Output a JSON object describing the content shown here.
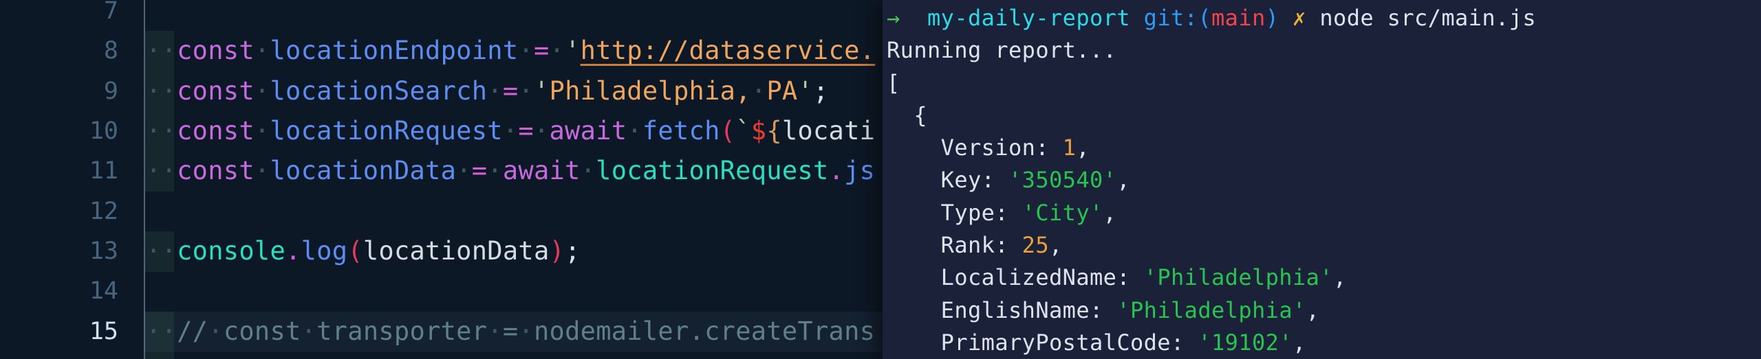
{
  "editor": {
    "colors": {
      "background": "#0d1826",
      "kw": "#c76ae0",
      "op": "#d45fd8",
      "var": "#5e8df2",
      "fn": "#5e8df2",
      "obj": "#28dfc0",
      "dot": "#d45fd8",
      "q": "#b5cbb0",
      "str": "#efa55e",
      "url": "#efa55e",
      "url_underline": "#cf7f35",
      "br": "#e43a5e",
      "dollar": "#ee3a2f",
      "brace": "#d89b57",
      "plain": "#d5dce4",
      "pn": "#dfe4ea",
      "cm": "#5e8086",
      "ws": "#3e5660",
      "line_number": "#47667d",
      "line_number_active": "#cfe3f5"
    },
    "lines": [
      {
        "num": "7",
        "active": false,
        "tokens": []
      },
      {
        "num": "8",
        "active": false,
        "tokens": [
          {
            "t": "··",
            "c": "ws"
          },
          {
            "t": "const",
            "c": "kw"
          },
          {
            "t": "·",
            "c": "ws"
          },
          {
            "t": "locationEndpoint",
            "c": "var"
          },
          {
            "t": "·",
            "c": "ws"
          },
          {
            "t": "=",
            "c": "op"
          },
          {
            "t": "·",
            "c": "ws"
          },
          {
            "t": "'",
            "c": "q"
          },
          {
            "t": "http://dataservice.",
            "c": "url",
            "u": true
          }
        ]
      },
      {
        "num": "9",
        "active": false,
        "tokens": [
          {
            "t": "··",
            "c": "ws"
          },
          {
            "t": "const",
            "c": "kw"
          },
          {
            "t": "·",
            "c": "ws"
          },
          {
            "t": "locationSearch",
            "c": "var"
          },
          {
            "t": "·",
            "c": "ws"
          },
          {
            "t": "=",
            "c": "op"
          },
          {
            "t": "·",
            "c": "ws"
          },
          {
            "t": "'",
            "c": "q"
          },
          {
            "t": "Philadelphia,",
            "c": "str"
          },
          {
            "t": "·",
            "c": "ws"
          },
          {
            "t": "PA",
            "c": "str"
          },
          {
            "t": "'",
            "c": "q"
          },
          {
            "t": ";",
            "c": "pn"
          }
        ]
      },
      {
        "num": "10",
        "active": false,
        "tokens": [
          {
            "t": "··",
            "c": "ws"
          },
          {
            "t": "const",
            "c": "kw"
          },
          {
            "t": "·",
            "c": "ws"
          },
          {
            "t": "locationRequest",
            "c": "var"
          },
          {
            "t": "·",
            "c": "ws"
          },
          {
            "t": "=",
            "c": "op"
          },
          {
            "t": "·",
            "c": "ws"
          },
          {
            "t": "await",
            "c": "kw"
          },
          {
            "t": "·",
            "c": "ws"
          },
          {
            "t": "fetch",
            "c": "fn"
          },
          {
            "t": "(",
            "c": "br"
          },
          {
            "t": "`",
            "c": "q"
          },
          {
            "t": "$",
            "c": "dollar"
          },
          {
            "t": "{",
            "c": "brace"
          },
          {
            "t": "locati",
            "c": "plain"
          }
        ]
      },
      {
        "num": "11",
        "active": false,
        "tokens": [
          {
            "t": "··",
            "c": "ws"
          },
          {
            "t": "const",
            "c": "kw"
          },
          {
            "t": "·",
            "c": "ws"
          },
          {
            "t": "locationData",
            "c": "var"
          },
          {
            "t": "·",
            "c": "ws"
          },
          {
            "t": "=",
            "c": "op"
          },
          {
            "t": "·",
            "c": "ws"
          },
          {
            "t": "await",
            "c": "kw"
          },
          {
            "t": "·",
            "c": "ws"
          },
          {
            "t": "locationRequest",
            "c": "obj"
          },
          {
            "t": ".",
            "c": "dot"
          },
          {
            "t": "js",
            "c": "fn"
          }
        ]
      },
      {
        "num": "12",
        "active": false,
        "tokens": []
      },
      {
        "num": "13",
        "active": false,
        "tokens": [
          {
            "t": "··",
            "c": "ws"
          },
          {
            "t": "console",
            "c": "obj"
          },
          {
            "t": ".",
            "c": "dot"
          },
          {
            "t": "log",
            "c": "fn"
          },
          {
            "t": "(",
            "c": "br"
          },
          {
            "t": "locationData",
            "c": "plain"
          },
          {
            "t": ")",
            "c": "br"
          },
          {
            "t": ";",
            "c": "pn"
          }
        ]
      },
      {
        "num": "14",
        "active": false,
        "tokens": []
      },
      {
        "num": "15",
        "active": true,
        "tokens": [
          {
            "t": "··",
            "c": "ws"
          },
          {
            "t": "//",
            "c": "cm"
          },
          {
            "t": "·",
            "c": "ws"
          },
          {
            "t": "const",
            "c": "cm"
          },
          {
            "t": "·",
            "c": "ws"
          },
          {
            "t": "transporter",
            "c": "cm"
          },
          {
            "t": "·",
            "c": "ws"
          },
          {
            "t": "=",
            "c": "cm"
          },
          {
            "t": "·",
            "c": "ws"
          },
          {
            "t": "nodemailer.createTrans",
            "c": "cm"
          }
        ]
      }
    ]
  },
  "terminal": {
    "colors": {
      "background": "#1b2138",
      "green": "#44c64f",
      "cyan": "#29dbe6",
      "blue": "#2e9bf5",
      "red": "#f4434f",
      "yellow": "#e9b13a",
      "white": "#dde3ef",
      "num": "#e9a23b",
      "str": "#28c44f"
    },
    "lines": [
      [
        {
          "t": "→",
          "c": "green"
        },
        {
          "t": "  ",
          "c": "white"
        },
        {
          "t": "my-daily-report",
          "c": "cyan"
        },
        {
          "t": " ",
          "c": "white"
        },
        {
          "t": "git:(",
          "c": "blue"
        },
        {
          "t": "main",
          "c": "red"
        },
        {
          "t": ")",
          "c": "blue"
        },
        {
          "t": " ",
          "c": "white"
        },
        {
          "t": "✗",
          "c": "yellow"
        },
        {
          "t": " ",
          "c": "white"
        },
        {
          "t": "node src/main.js",
          "c": "white"
        }
      ],
      [
        {
          "t": "Running report...",
          "c": "white"
        }
      ],
      [
        {
          "t": "[",
          "c": "white"
        }
      ],
      [
        {
          "t": "  {",
          "c": "white"
        }
      ],
      [
        {
          "t": "    Version: ",
          "c": "white"
        },
        {
          "t": "1",
          "c": "num"
        },
        {
          "t": ",",
          "c": "white"
        }
      ],
      [
        {
          "t": "    Key: ",
          "c": "white"
        },
        {
          "t": "'350540'",
          "c": "str"
        },
        {
          "t": ",",
          "c": "white"
        }
      ],
      [
        {
          "t": "    Type: ",
          "c": "white"
        },
        {
          "t": "'City'",
          "c": "str"
        },
        {
          "t": ",",
          "c": "white"
        }
      ],
      [
        {
          "t": "    Rank: ",
          "c": "white"
        },
        {
          "t": "25",
          "c": "num"
        },
        {
          "t": ",",
          "c": "white"
        }
      ],
      [
        {
          "t": "    LocalizedName: ",
          "c": "white"
        },
        {
          "t": "'Philadelphia'",
          "c": "str"
        },
        {
          "t": ",",
          "c": "white"
        }
      ],
      [
        {
          "t": "    EnglishName: ",
          "c": "white"
        },
        {
          "t": "'Philadelphia'",
          "c": "str"
        },
        {
          "t": ",",
          "c": "white"
        }
      ],
      [
        {
          "t": "    PrimaryPostalCode: ",
          "c": "white"
        },
        {
          "t": "'19102'",
          "c": "str"
        },
        {
          "t": ",",
          "c": "white"
        }
      ]
    ]
  }
}
